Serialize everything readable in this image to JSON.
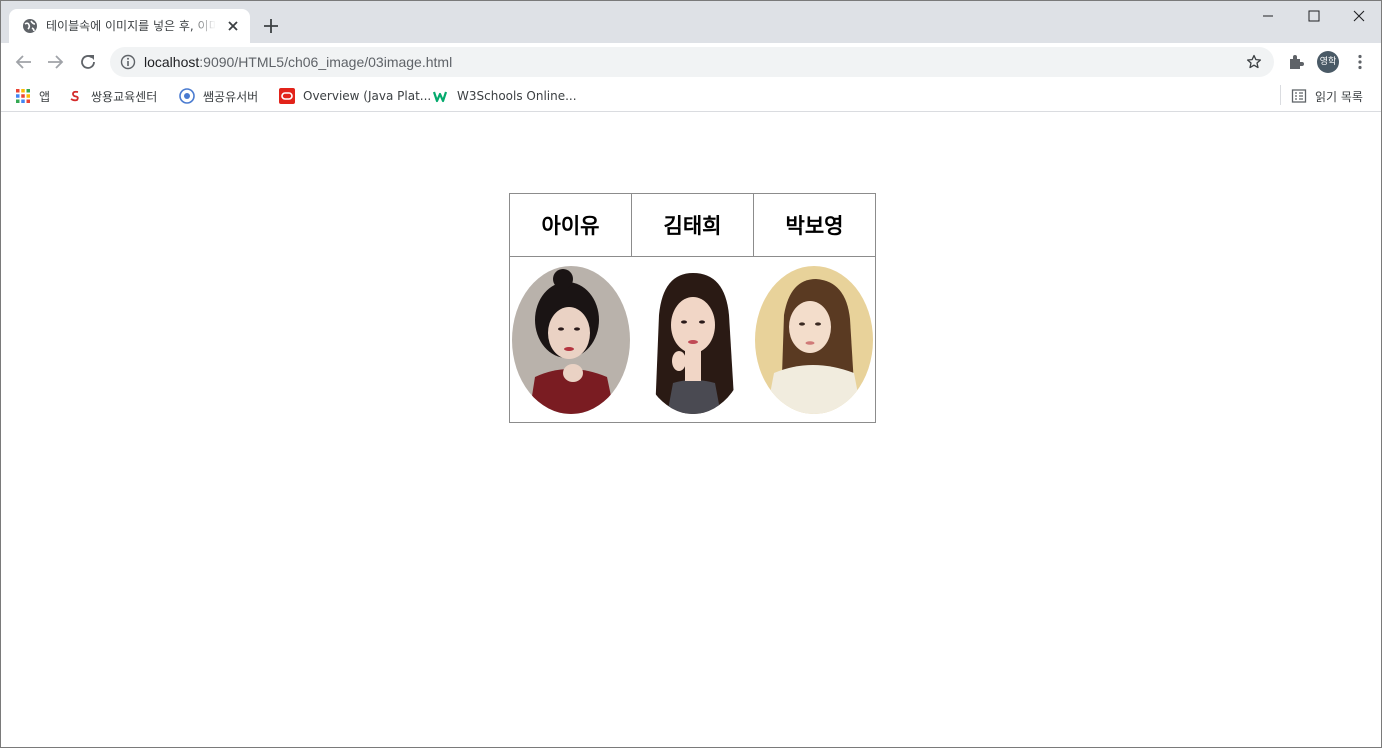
{
  "browser": {
    "tab_title": "테이블속에 이미지를 넣은 후, 이미지 모양을 바꾸기",
    "url_host": "localhost",
    "url_path": ":9090/HTML5/ch06_image/03image.html",
    "profile_initials": "영학"
  },
  "bookmarks": {
    "items": [
      {
        "label": "앱",
        "icon": "apps-grid-icon"
      },
      {
        "label": "쌍용교육센터",
        "icon": "ssangyong-logo-icon"
      },
      {
        "label": "쌤공유서버",
        "icon": "share-server-icon"
      },
      {
        "label": "Overview (Java Plat...",
        "icon": "oracle-icon"
      },
      {
        "label": "W3Schools Online...",
        "icon": "w3schools-icon"
      }
    ],
    "reading_list": "읽기 목록"
  },
  "table": {
    "headers": [
      "아이유",
      "김태희",
      "박보영"
    ],
    "images": [
      {
        "icon": "portrait-iu",
        "bg": "#b9b2ab",
        "hair": "#1a1414",
        "top": "#7a1c22"
      },
      {
        "icon": "portrait-kimtaehee",
        "bg": "#ffffff",
        "hair": "#2a1a14",
        "top": "#4a4a52"
      },
      {
        "icon": "portrait-parkboyoung",
        "bg": "#e8d29a",
        "hair": "#5a3a22",
        "top": "#f1ecde"
      }
    ]
  }
}
